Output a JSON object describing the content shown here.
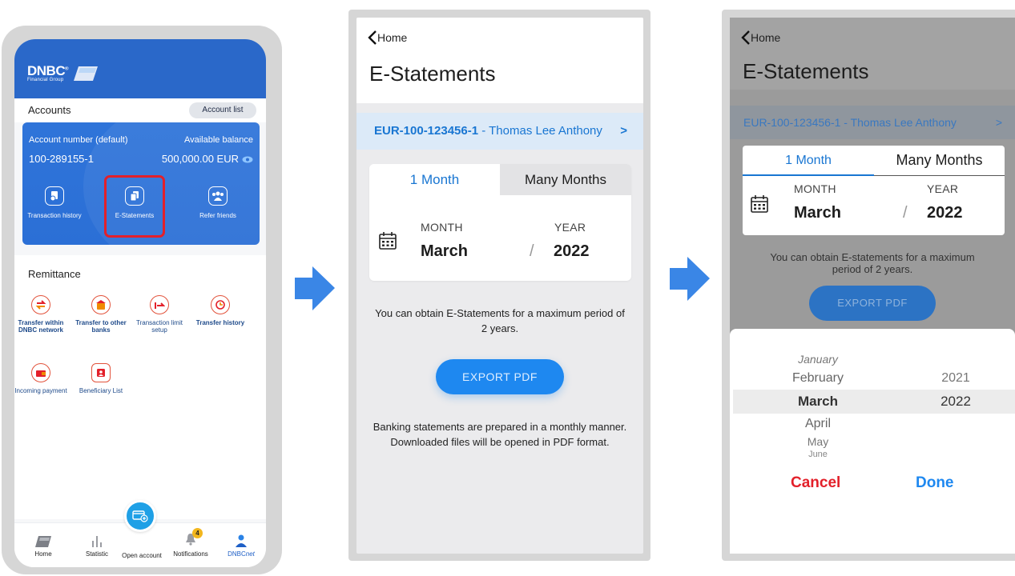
{
  "screen1": {
    "brand": {
      "name": "DNBC",
      "reg": "®",
      "tagline": "Financial Group"
    },
    "accounts": {
      "title": "Accounts",
      "account_list_label": "Account list",
      "account_number_label": "Account number (default)",
      "available_balance_label": "Available balance",
      "account_number": "100-289155-1",
      "balance": "500,000.00 EUR",
      "quick_actions": [
        {
          "label": "Transaction history",
          "icon": "transaction-history-icon"
        },
        {
          "label": "E-Statements",
          "icon": "e-statements-icon"
        },
        {
          "label": "Refer friends",
          "icon": "refer-friends-icon"
        }
      ]
    },
    "remittance": {
      "title": "Remittance",
      "items": [
        {
          "label": "Transfer within DNBC network",
          "icon": "transfer-within-icon"
        },
        {
          "label": "Transfer to other banks",
          "icon": "transfer-other-banks-icon"
        },
        {
          "label": "Transaction limit setup",
          "icon": "limit-setup-icon"
        },
        {
          "label": "Transfer history",
          "icon": "transfer-history-icon"
        },
        {
          "label": "Incoming payment",
          "icon": "incoming-payment-icon"
        },
        {
          "label": "Beneficiary List",
          "icon": "beneficiary-list-icon"
        }
      ]
    },
    "nav": {
      "home": "Home",
      "statistic": "Statistic",
      "open_account": "Open account",
      "notifications": "Notifications",
      "notifications_count": "4",
      "profile": "DNBC",
      "profile_suffix": "net"
    }
  },
  "screen2": {
    "back_label": "Home",
    "title": "E-Statements",
    "account_code": "EUR-100-123456-1",
    "account_sep": " - ",
    "account_holder": "Thomas Lee Anthony",
    "tab_one_month": "1 Month",
    "tab_many_months": "Many Months",
    "month_label": "MONTH",
    "year_label": "YEAR",
    "month_value": "March",
    "year_value": "2022",
    "slash": "/",
    "info": "You can obtain E-Statements for a maximum period of 2 years.",
    "export_label": "EXPORT PDF",
    "footer_note_1": "Banking statements are prepared in a monthly manner.",
    "footer_note_2": "Downloaded files will be opened in PDF format."
  },
  "screen3": {
    "back_label": "Home",
    "title": "E-Statements",
    "account_text": "EUR-100-123456-1 - Thomas Lee Anthony",
    "tab_one_month": "1 Month",
    "tab_many_months": "Many Months",
    "month_label": "MONTH",
    "year_label": "YEAR",
    "month_value": "March",
    "year_value": "2022",
    "slash": "/",
    "info_1": "You can obtain E-statements for a maximum",
    "info_2": "period of 2 years.",
    "export_label": "EXPORT PDF",
    "picker": {
      "months": [
        "January",
        "February",
        "March",
        "April",
        "May",
        "June"
      ],
      "years": [
        "2021",
        "2022"
      ],
      "selected_month": "March",
      "selected_year": "2022",
      "cancel_label": "Cancel",
      "done_label": "Done"
    }
  },
  "colors": {
    "brand_blue": "#2a68c9",
    "accent_blue": "#1976d2",
    "button_blue": "#1e88f0",
    "highlight_red": "#e3202a",
    "cancel_red": "#e3202a",
    "flow_arrow": "#3a86e6"
  }
}
